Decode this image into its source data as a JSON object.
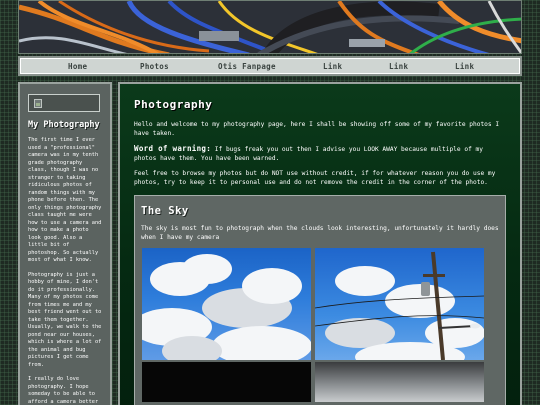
{
  "nav": {
    "items": [
      {
        "label": "Home"
      },
      {
        "label": "Photos"
      },
      {
        "label": "Otis Fanpage"
      },
      {
        "label": "Link"
      },
      {
        "label": "Link"
      },
      {
        "label": "Link"
      }
    ]
  },
  "sidebar": {
    "heading": "My Photography",
    "paragraphs": [
      "The first time I ever used a \"professional\" camera was in my tenth grade photography class, though I was no stranger to taking ridiculous photos of random things with my phone before then. The only things photography class taught me were how to use a camera and how to make a photo look good. Also a little bit of photoshop. So actually most of what I know.",
      "Photography is just a hobby of mine, I don't do it professionally. Many of my photos come from times me and my best friend went out to take them together. Usually, we walk to the pond near our houses, which is where a lot of the animal and bug pictures I get come from.",
      "I really do love photography. I hope someday to be able to afford a camera better than the one I"
    ]
  },
  "main": {
    "title": "Photography",
    "intro": "Hello and welcome to my photography page, here I shall be showing off some of my favorite photos I have taken.",
    "warning_label": "Word of warning:",
    "warning_text": " If bugs freak you out then I advise you LOOK AWAY because multiple of my photos have them. You have been warned.",
    "credit": "Feel free to browse my photos but do NOT use without credit, if for whatever reason you do use my photos, try to keep it to personal use and do not remove the credit in the corner of the photo."
  },
  "section": {
    "title": "The Sky",
    "text": "The sky is most fun to photograph when the clouds look interesting, unfortunately it hardly does when I have my camera"
  }
}
